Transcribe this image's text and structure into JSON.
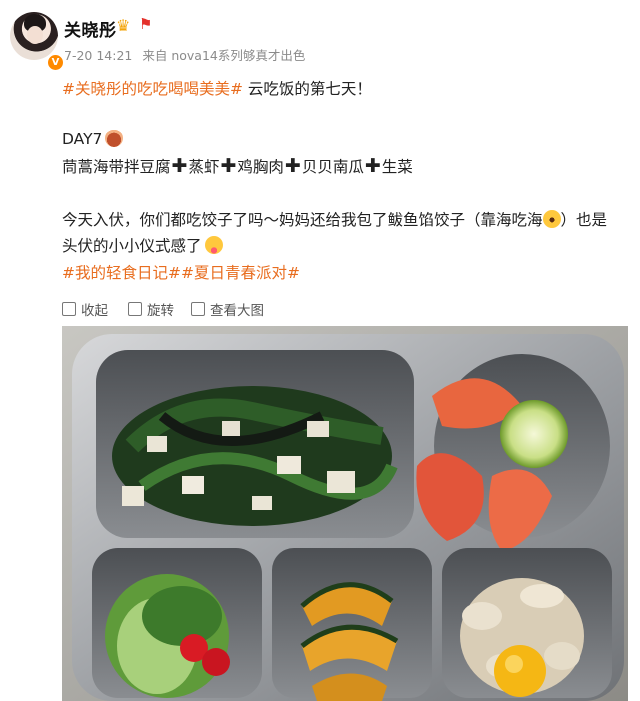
{
  "author": {
    "name": "关晓彤",
    "verified_badge": "V",
    "crown_icon": "crown-icon",
    "flag_icon": "flag-icon"
  },
  "post_meta": {
    "time": "7-20 14:21",
    "source": "来自 nova14系列够真才出色"
  },
  "post": {
    "hashtag_main": "#关晓彤的吃吃喝喝美美#",
    "headline": " 云吃饭的第七天！",
    "day_label": "DAY7",
    "menu_items": [
      "茼蒿海带拌豆腐",
      "蒸虾",
      "鸡胸肉",
      "贝贝南瓜",
      "生菜"
    ],
    "body_line1": "今天入伏，你们都吃饺子了吗～妈妈还给我包了鲅鱼馅饺子（靠海吃海",
    "body_line1_end": "）也是",
    "body_line2": "头伏的小小仪式感了",
    "tag_line": "#我的轻食日记##夏日青春派对#"
  },
  "actions": {
    "collapse": "收起",
    "repost": "旋转",
    "view_large": "查看大图"
  },
  "colors": {
    "hashtag": "#e86d1f",
    "meta": "#8b8b8b",
    "badge": "#ff8a00"
  }
}
